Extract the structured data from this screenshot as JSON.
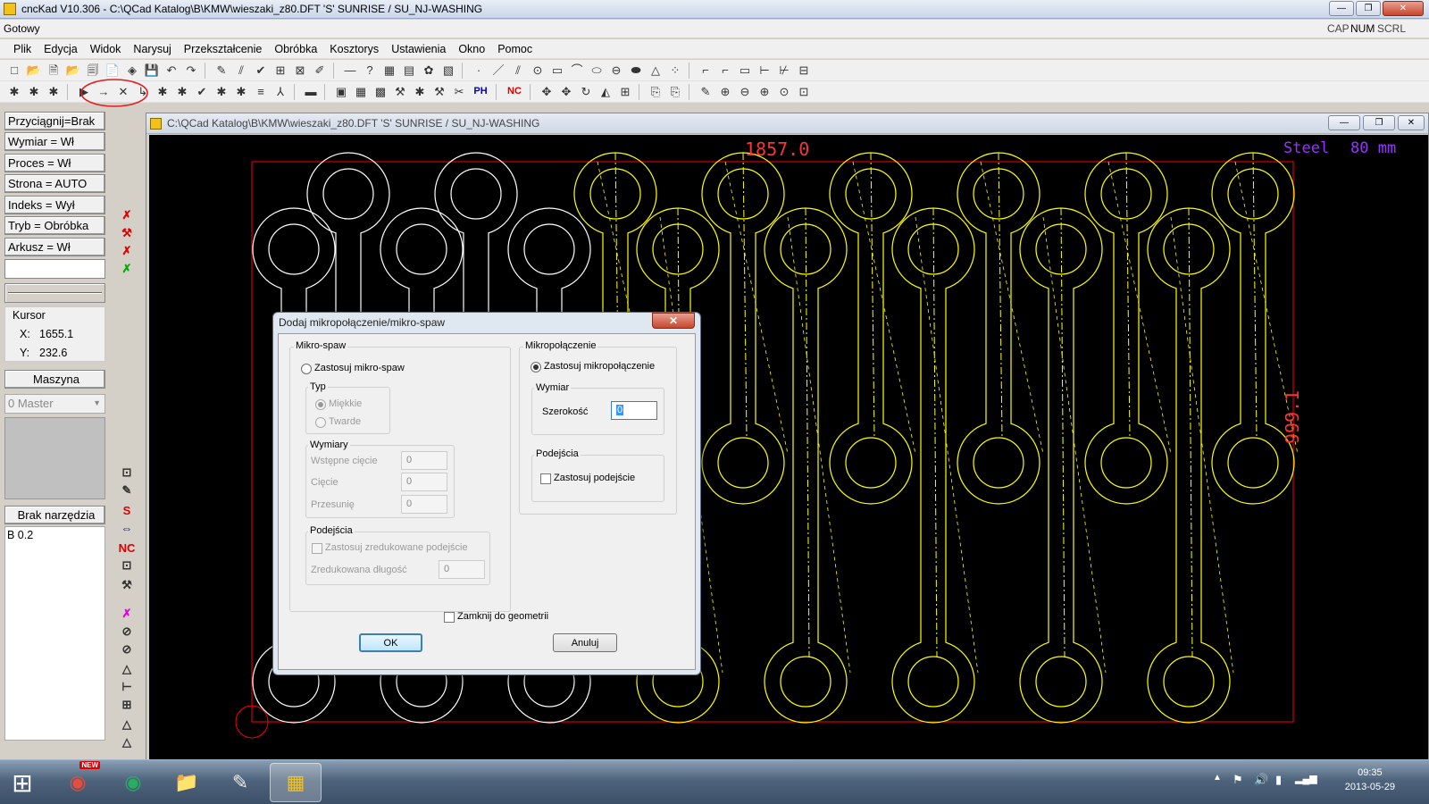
{
  "window": {
    "title": "cncKad V10.306 - C:\\QCad Katalog\\B\\KMW\\wieszaki_z80.DFT  'S'  SUNRISE / SU_NJ-WASHING",
    "buttons": {
      "minimize": "—",
      "maximize": "❐",
      "close": "✕"
    }
  },
  "statusline": {
    "text": "Gotowy",
    "indicators": [
      "CAP",
      "NUM",
      "SCRL"
    ]
  },
  "menu": [
    "Plik",
    "Edycja",
    "Widok",
    "Narysuj",
    "Przekształcenie",
    "Obróbka",
    "Kosztorys",
    "Ustawienia",
    "Okno",
    "Pomoc"
  ],
  "toolbar1": [
    "□",
    "📂",
    "🗎",
    "📂",
    "🗐",
    "📄",
    "◈",
    "💾",
    "↶",
    "↷",
    "|",
    "✎",
    "⫽",
    "✔",
    "⊞",
    "⊠",
    "✐",
    "|",
    "—",
    "?",
    "▦",
    "▤",
    "✿",
    "▧",
    "|",
    "·",
    "／",
    "⫽",
    "⊙",
    "▭",
    "⌒",
    "⬭",
    "⊖",
    "⬬",
    "△",
    "⁘",
    "|",
    "⌐",
    "⌐",
    "▭",
    "⊢",
    "⊬",
    "⊟"
  ],
  "toolbar2": [
    "✱",
    "✱",
    "✱",
    "|",
    "▶",
    "→",
    "✕",
    "↳",
    "✱",
    "✱",
    "✔",
    "✱",
    "✱",
    "≡",
    "⅄",
    "|",
    "▬",
    "|",
    "▣",
    "▦",
    "▩",
    "⚒",
    "✱",
    "⚒",
    "✂",
    "PH",
    "|",
    "NC",
    "|",
    "✥",
    "✥",
    "↻",
    "◭",
    "⊞",
    "|",
    "⎘",
    "⎘",
    "|",
    "✎",
    "⊕",
    "⊖",
    "⊕",
    "⊙",
    "⊡"
  ],
  "left_panel": {
    "buttons": [
      "Przyciągnij=Brak",
      "Wymiar = Wł",
      "Proces = Wł",
      "Strona  = AUTO",
      "Indeks = Wył",
      "Tryb = Obróbka",
      "Arkusz = Wł"
    ],
    "cursor_label": "Kursor",
    "x_label": "X:",
    "x_value": "1655.1",
    "y_label": "Y:",
    "y_value": "232.6",
    "machine_button": "Maszyna",
    "machine_select": "0 Master",
    "tool_button": "Brak narzędzia",
    "tool_value": "B 0.2"
  },
  "side_strip": [
    "✗",
    "⚒",
    "✗",
    "✗",
    "⊡",
    "✎",
    "S",
    "⇔",
    "NC",
    "⊡",
    "⚒",
    "✗",
    "⊘",
    "⊘",
    "△",
    "⊢",
    "⊞",
    "△",
    "△"
  ],
  "document": {
    "title": "C:\\QCad Katalog\\B\\KMW\\wieszaki_z80.DFT  'S'  SUNRISE / SU_NJ-WASHING",
    "buttons": [
      "—",
      "❐",
      "✕"
    ]
  },
  "canvas": {
    "width_label": "1857.0",
    "height_label": "999.1",
    "material_label": "Steel",
    "thickness_label": "80 mm",
    "colors": {
      "background": "#000000",
      "part": "#ffffff",
      "selected": "#ffff00",
      "sheet": "#ff0000",
      "label": "#ff3333",
      "material": "#9933ff"
    }
  },
  "dialog": {
    "title": "Dodaj mikropołączenie/mikro-spaw",
    "close": "✕",
    "mikrospaw": {
      "group_label": "Mikro-spaw",
      "apply_label": "Zastosuj mikro-spaw",
      "type_label": "Typ",
      "soft_label": "Miękkie",
      "hard_label": "Twarde",
      "dims_label": "Wymiary",
      "initial_cut_label": "Wstępne cięcie",
      "initial_cut_value": "0",
      "cut_label": "Cięcie",
      "cut_value": "0",
      "shift_label": "Przesunię",
      "shift_value": "0",
      "approach_label": "Podejścia",
      "reduced_approach_label": "Zastosuj zredukowane podejście",
      "reduced_length_label": "Zredukowana długość",
      "reduced_length_value": "0"
    },
    "mikropolaczenie": {
      "group_label": "Mikropołączenie",
      "apply_label": "Zastosuj mikropołączenie",
      "dim_label": "Wymiar",
      "width_label": "Szerokość",
      "width_value": "0",
      "approach_label": "Podejścia",
      "apply_approach_label": "Zastosuj podejście"
    },
    "close_to_geometry_label": "Zamknij do geometrii",
    "ok_label": "OK",
    "cancel_label": "Anuluj"
  },
  "taskbar": {
    "start": "⊞",
    "new_badge": "NEW",
    "items": [
      "◉",
      "◉",
      "📁",
      "✎",
      "▦"
    ],
    "tray": [
      "▲",
      "⚑",
      "🔊",
      "▮",
      "▂▄▆"
    ],
    "time": "09:35",
    "date": "2013-05-29"
  }
}
